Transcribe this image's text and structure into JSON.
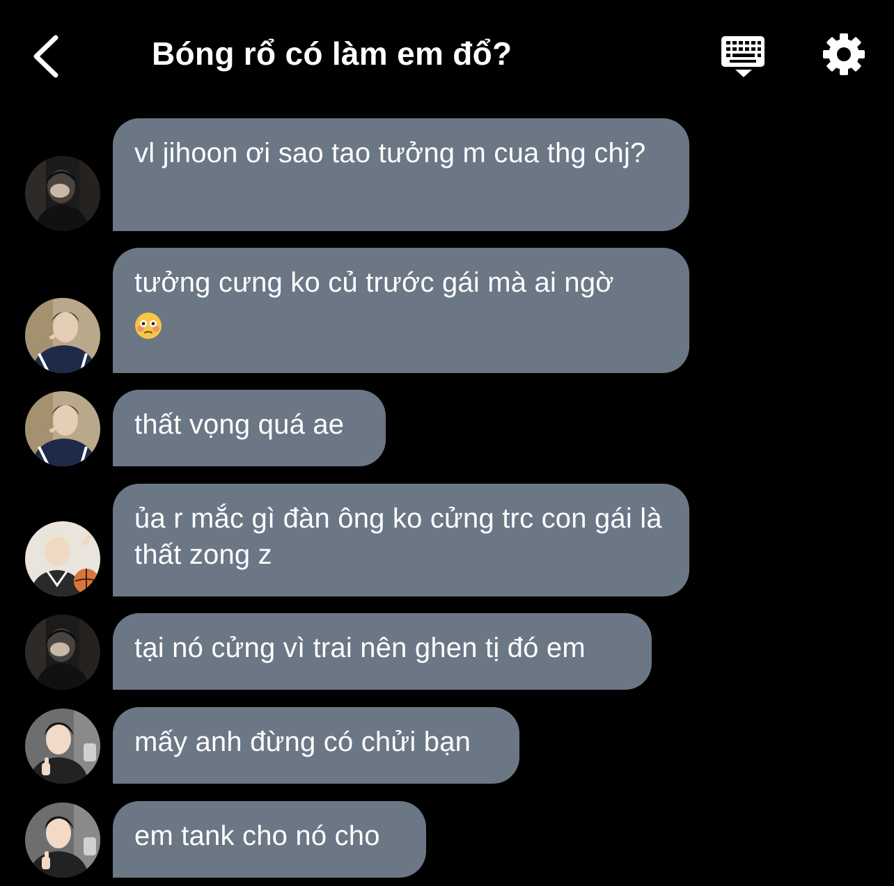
{
  "header": {
    "title": "Bóng rổ có làm em đổ?",
    "back_icon": "chevron-left-icon",
    "keyboard_icon": "keyboard-icon",
    "settings_icon": "gear-icon"
  },
  "colors": {
    "background": "#000000",
    "bubble": "#6b7785",
    "text": "#ffffff"
  },
  "messages": [
    {
      "text": "vl jihoon ơi sao tao tưởng m cua thg chj?",
      "avatar": "avatar-dark-hoodie"
    },
    {
      "text": "tưởng cưng ko củ trước gái mà ai ngờ",
      "emoji": "😳",
      "avatar": "avatar-varsity-jacket"
    },
    {
      "text": "thất vọng quá ae",
      "avatar": "avatar-varsity-jacket"
    },
    {
      "text": "ủa r mắc gì đàn ông ko cửng trc con gái là thất zong z",
      "avatar": "avatar-blonde-basketball"
    },
    {
      "text": "tại nó cửng vì trai nên ghen tị đó em",
      "avatar": "avatar-dark-hoodie"
    },
    {
      "text": "mấy anh đừng có chửi bạn",
      "avatar": "avatar-thumbs-up"
    },
    {
      "text": "em tank cho nó cho",
      "avatar": "avatar-thumbs-up"
    }
  ]
}
